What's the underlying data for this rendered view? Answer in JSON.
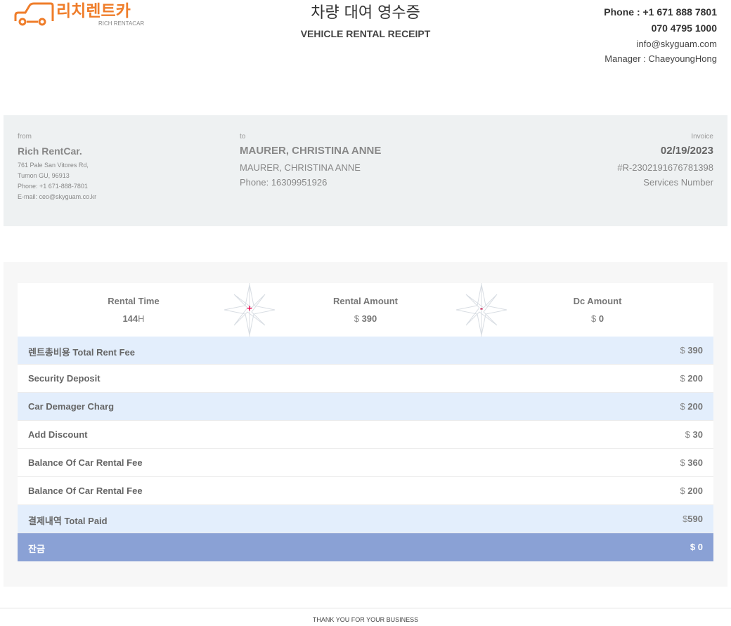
{
  "header": {
    "logo_text_ko": "리치렌트카",
    "logo_text_en": "RICH RENTACAR",
    "title_ko": "차량 대여 영수증",
    "title_en": "VEHICLE RENTAL RECEIPT",
    "phone_line": "Phone : +1 671 888 7801",
    "phone_alt": "070 4795 1000",
    "email": "info@skyguam.com",
    "manager": "Manager : ChaeyoungHong"
  },
  "from": {
    "label": "from",
    "name": "Rich RentCar.",
    "address1": "761 Pale San Vitores Rd,",
    "address2": "Tumon GU, 96913",
    "phone": "Phone: +1 671-888-7801",
    "email": "E-mail: ceo@skyguam.co.kr"
  },
  "to": {
    "label": "to",
    "name": "MAURER, CHRISTINA ANNE",
    "name2": "MAURER, CHRISTINA ANNE",
    "phone": "Phone: 16309951926"
  },
  "invoice": {
    "label": "Invoice",
    "date": "02/19/2023",
    "number": "#R-2302191676781398",
    "services": "Services Number"
  },
  "metrics": {
    "rental_time": {
      "label": "Rental Time",
      "value": "144",
      "unit": "H"
    },
    "rental_amount": {
      "label": "Rental Amount",
      "currency": "$",
      "value": "390"
    },
    "dc_amount": {
      "label": "Dc Amount",
      "currency": "$",
      "value": "0"
    },
    "op_plus": "+",
    "op_minus": "-"
  },
  "colors": {
    "plus": "#e8004a",
    "minus": "#c0003a",
    "logo_orange": "#ef7d2a",
    "row_blue": "#e3eefc",
    "row_dark": "#8aa1d5"
  },
  "rows": [
    {
      "label": "렌트총비용 Total Rent Fee",
      "currency": "$",
      "value": "390"
    },
    {
      "label": "Security Deposit",
      "currency": "$",
      "value": "200"
    },
    {
      "label": "Car Demager Charg",
      "currency": "$",
      "value": "200"
    },
    {
      "label": "Add Discount",
      "currency": "$",
      "value": "30"
    },
    {
      "label": "Balance Of Car Rental Fee",
      "currency": "$",
      "value": "360"
    },
    {
      "label": "Balance Of Car Rental Fee",
      "currency": "$",
      "value": "200"
    },
    {
      "label": "결제내역 Total Paid",
      "currency": "$",
      "value": "590"
    },
    {
      "label": "잔금",
      "currency": "$",
      "value": "0"
    }
  ],
  "footer": "THANK YOU FOR YOUR BUSINESS"
}
